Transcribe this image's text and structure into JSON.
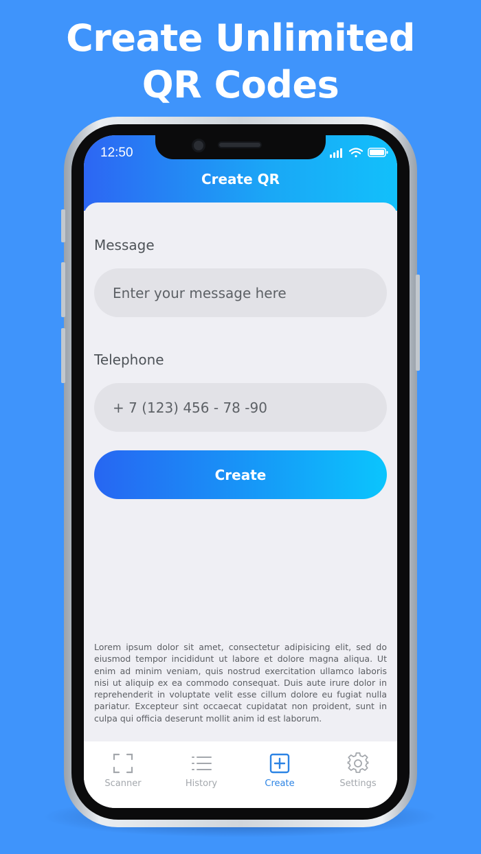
{
  "promo": {
    "headline_line1": "Create Unlimited",
    "headline_line2": "QR Codes"
  },
  "status_bar": {
    "time": "12:50"
  },
  "header": {
    "title": "Create QR"
  },
  "form": {
    "message_label": "Message",
    "message_placeholder": "Enter your message here",
    "telephone_label": "Telephone",
    "telephone_placeholder": "+ 7 (123) 456 - 78 -90",
    "create_label": "Create"
  },
  "footer_text": "Lorem ipsum dolor sit amet, consectetur adipisicing elit, sed do eiusmod tempor incididunt ut labore et dolore magna aliqua. Ut enim ad minim veniam, quis nostrud exercitation ullamco laboris nisi ut aliquip ex ea commodo consequat. Duis aute irure dolor in reprehenderit in voluptate velit esse cillum dolore eu fugiat nulla pariatur. Excepteur sint occaecat cupidatat non proident, sunt in culpa qui officia deserunt mollit anim id est laborum.",
  "tabbar": {
    "items": [
      {
        "label": "Scanner",
        "icon": "scanner-frame-icon",
        "active": false
      },
      {
        "label": "History",
        "icon": "list-icon",
        "active": false
      },
      {
        "label": "Create",
        "icon": "plus-square-icon",
        "active": true
      },
      {
        "label": "Settings",
        "icon": "gear-icon",
        "active": false
      }
    ]
  },
  "colors": {
    "background": "#3f94fb",
    "accent": "#2b83e4",
    "gradient_start": "#2766f2",
    "gradient_end": "#0bc5fd"
  }
}
